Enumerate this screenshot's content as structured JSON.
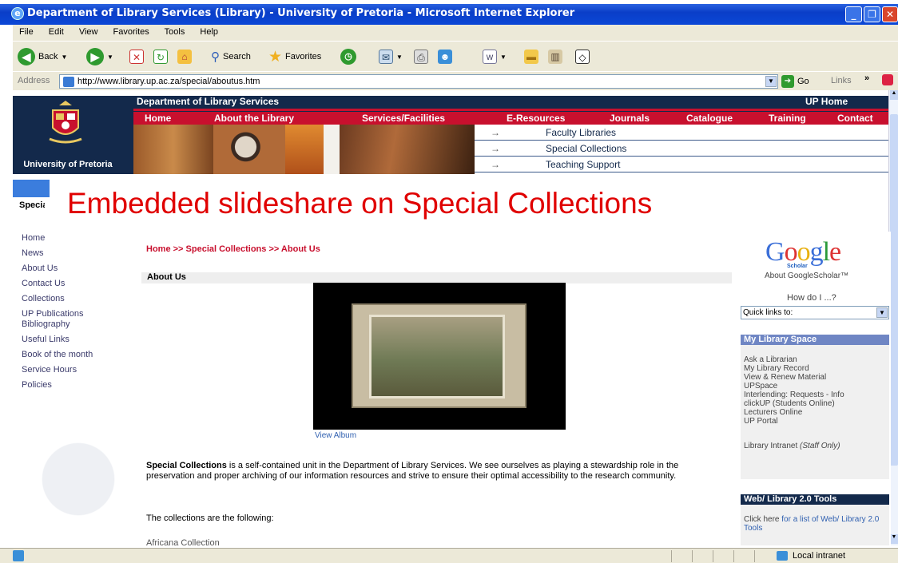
{
  "window": {
    "title": "Department of Library Services (Library) - University of Pretoria - Microsoft Internet Explorer",
    "controls": [
      "_",
      "❐",
      "✕"
    ]
  },
  "menu": [
    "File",
    "Edit",
    "View",
    "Favorites",
    "Tools",
    "Help"
  ],
  "toolbar": {
    "back": "Back",
    "search": "Search",
    "favorites": "Favorites"
  },
  "address": {
    "label": "Address",
    "url": "http://www.library.up.ac.za/special/aboutus.htm",
    "go": "Go",
    "links": "Links"
  },
  "header": {
    "dept": "Department of Library Services",
    "up_home": "UP Home",
    "logo_text": "University of Pretoria"
  },
  "nav": [
    "Home",
    "About the Library",
    "Services/Facilities",
    "E-Resources",
    "Journals",
    "Catalogue",
    "Training",
    "Contact"
  ],
  "submenu": [
    "Faculty Libraries",
    "Special Collections",
    "Teaching Support"
  ],
  "overlay": "Embedded slideshare on Special Collections",
  "left_nav": {
    "section_cut": "Special Collections",
    "items": [
      "Home",
      "News",
      "About Us",
      "Contact Us",
      "Collections",
      "UP Publications Bibliography",
      "Useful Links",
      "Book of the month",
      "Service Hours",
      "Policies"
    ]
  },
  "main": {
    "breadcrumb": "Home  >>  Special Collections  >>  About Us",
    "heading": "About Us",
    "view_album": "View Album",
    "para1_bold": "Special Collections",
    "para1_rest": " is a self-contained unit in the Department of Library Services. We see ourselves as playing a stewardship role in the preservation and proper archiving of our information resources and strive to ensure their optimal accessibility to the research community.",
    "para2": "The collections are the following:",
    "africana": "Africana Collection"
  },
  "right": {
    "google_sub": "Scholar",
    "about_gs": "About GoogleScholar™",
    "howdo": "How do I ...?",
    "quick_links": "Quick links to:",
    "mls_title": "My Library Space",
    "mls_items": [
      "Ask a Librarian",
      "My Library Record",
      "View & Renew Material",
      "UPSpace",
      "Interlending: Requests  -  Info",
      "clickUP (Students Online)",
      "Lecturers Online",
      "UP Portal"
    ],
    "intranet": "Library Intranet",
    "intranet_note": "(Staff Only)",
    "web_title": "Web/ Library 2.0 Tools",
    "web_text_a": "Click here ",
    "web_text_b": "for a list of Web/ Library 2.0 Tools"
  },
  "status": {
    "zone": "Local intranet"
  },
  "colors": {
    "ie_blue": "#0a3ec8",
    "up_navy": "#13294b",
    "up_red": "#c8102e",
    "overlay_red": "#e00000"
  }
}
